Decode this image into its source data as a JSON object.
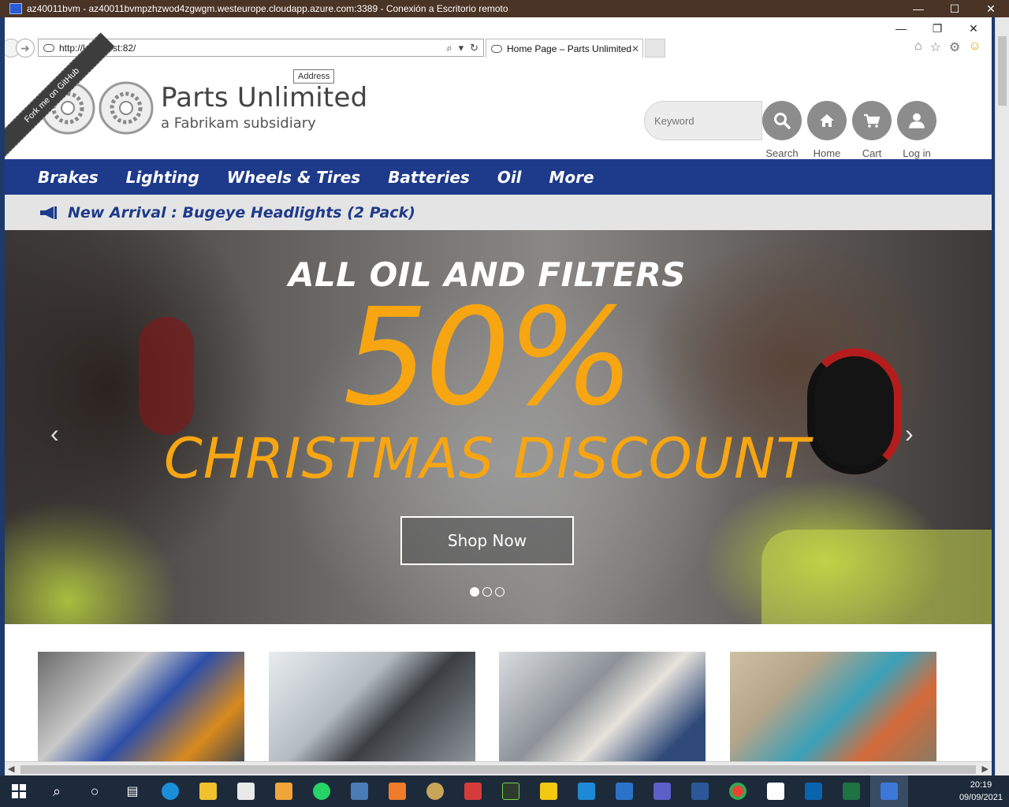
{
  "rdp": {
    "title": "az40011bvm - az40011bvmpzhzwod4zgwgm.westeurope.cloudapp.azure.com:3389 - Conexión a Escritorio remoto",
    "controls": [
      "—",
      "☐",
      "✕"
    ]
  },
  "browser": {
    "url": "http://localhost:82/",
    "tab_title": "Home Page – Parts Unlimited",
    "tooltip": "Address",
    "controls": [
      "—",
      "❐",
      "✕"
    ],
    "tools_icons": [
      "home-icon",
      "star-icon",
      "gear-icon",
      "smiley-icon"
    ]
  },
  "header": {
    "ribbon": "Fork me on GitHub",
    "brand_name": "Parts Unlimited",
    "brand_sub": "a Fabrikam subsidiary",
    "search_placeholder": "Keyword",
    "actions": {
      "search": "Search",
      "home": "Home",
      "cart": "Cart",
      "login": "Log in"
    }
  },
  "nav": {
    "items": [
      "Brakes",
      "Lighting",
      "Wheels & Tires",
      "Batteries",
      "Oil",
      "More"
    ]
  },
  "announcement": {
    "text": "New Arrival : Bugeye Headlights (2 Pack)"
  },
  "hero": {
    "line1": "ALL OIL AND FILTERS",
    "line2": "50%",
    "line3": "CHRISTMAS DISCOUNT",
    "cta": "Shop Now",
    "prev": "‹",
    "next": "›",
    "slide_count": 3,
    "active_slide": 1
  },
  "colors": {
    "nav_blue": "#1e3a8a",
    "accent_orange": "#f7a612",
    "icon_gray": "#8c8c8c"
  },
  "taskbar": {
    "time": "20:19",
    "date": "09/09/2021"
  }
}
